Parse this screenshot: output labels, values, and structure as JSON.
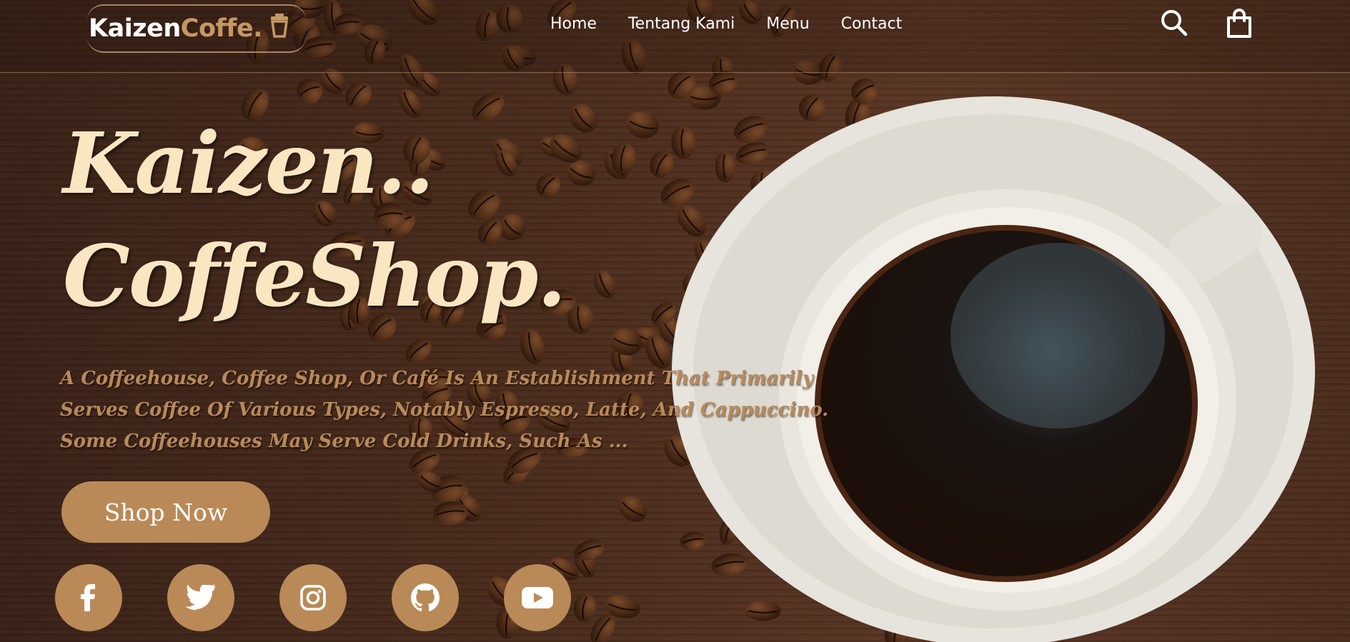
{
  "brand": {
    "name_part1": "Kaizen",
    "name_part2": "Coffe."
  },
  "nav": {
    "links": [
      {
        "label": "Home"
      },
      {
        "label": "Tentang Kami"
      },
      {
        "label": "Menu"
      },
      {
        "label": "Contact"
      }
    ],
    "icons": [
      "search-icon",
      "shopping-bag-icon"
    ]
  },
  "hero": {
    "title_line1": "Kaizen..",
    "title_line2": "CoffeShop.",
    "description": "A Coffeehouse, Coffee Shop, Or Café Is An Establishment That Primarily Serves Coffee Of Various Types, Notably Espresso, Latte, And Cappuccino. Some Coffeehouses May Serve Cold Drinks, Such As ...",
    "cta_label": "Shop Now"
  },
  "socials": [
    "facebook-icon",
    "twitter-icon",
    "instagram-icon",
    "github-icon",
    "youtube-icon"
  ],
  "colors": {
    "accent": "#b98a57",
    "title": "#fbe6c2",
    "description": "#b98959",
    "nav_text": "#ffffff",
    "background": "#3b2417"
  }
}
